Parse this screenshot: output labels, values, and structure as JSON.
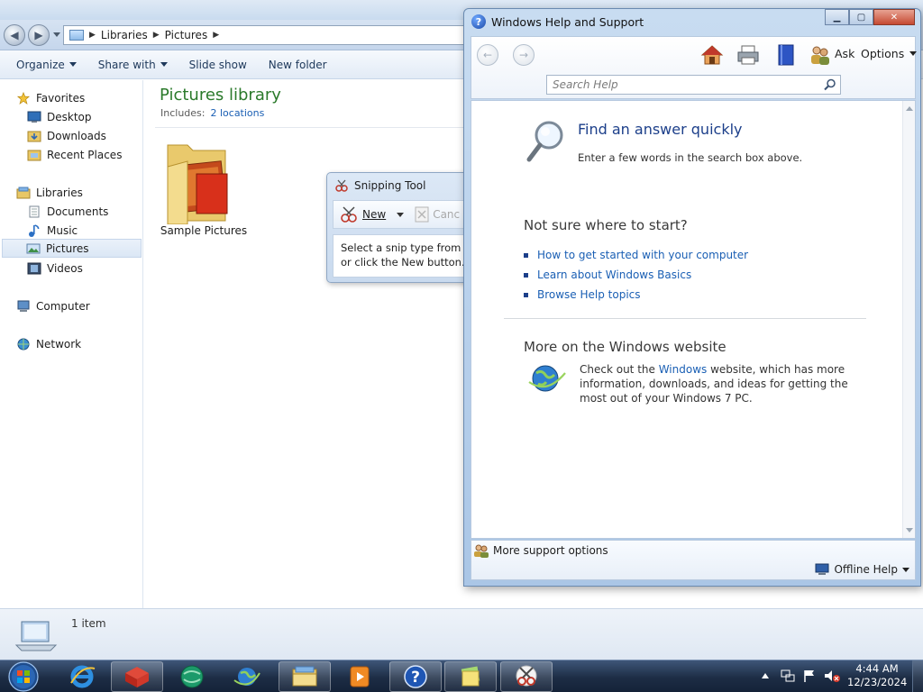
{
  "explorer": {
    "breadcrumb": [
      "Libraries",
      "Pictures"
    ],
    "toolbar": {
      "organize": "Organize",
      "share_with": "Share with",
      "slide_show": "Slide show",
      "new_folder": "New folder"
    },
    "nav": {
      "favorites": "Favorites",
      "desktop": "Desktop",
      "downloads": "Downloads",
      "recent_places": "Recent Places",
      "libraries": "Libraries",
      "documents": "Documents",
      "music": "Music",
      "pictures": "Pictures",
      "videos": "Videos",
      "computer": "Computer",
      "network": "Network"
    },
    "library": {
      "title": "Pictures library",
      "includes_label": "Includes:",
      "includes_link": "2 locations"
    },
    "items": [
      {
        "label": "Sample Pictures"
      }
    ],
    "status": {
      "count": "1 item"
    }
  },
  "snipping_tool": {
    "title": "Snipping Tool",
    "new_label": "New",
    "cancel_label": "Canc",
    "body_line1": "Select a snip type from the",
    "body_line2": "or click the New button."
  },
  "help": {
    "title": "Windows Help and Support",
    "toolbar": {
      "ask": "Ask",
      "options": "Options"
    },
    "search_placeholder": "Search Help",
    "find": {
      "heading": "Find an answer quickly",
      "sub": "Enter a few words in the search box above."
    },
    "not_sure": {
      "heading": "Not sure where to start?",
      "links": [
        "How to get started with your computer",
        "Learn about Windows Basics",
        "Browse Help topics"
      ]
    },
    "more_web": {
      "heading": "More on the Windows website",
      "text_before": "Check out the ",
      "link": "Windows",
      "text_after": " website, which has more information, downloads, and ideas for getting the most out of your Windows 7 PC."
    },
    "footer": {
      "more_support": "More support options",
      "offline_help": "Offline Help"
    }
  },
  "taskbar": {
    "time": "4:44 AM",
    "date": "12/23/2024"
  },
  "colors": {
    "library_title": "#2b7a2b",
    "link": "#1a5fb4",
    "help_heading": "#1c3f8a"
  }
}
